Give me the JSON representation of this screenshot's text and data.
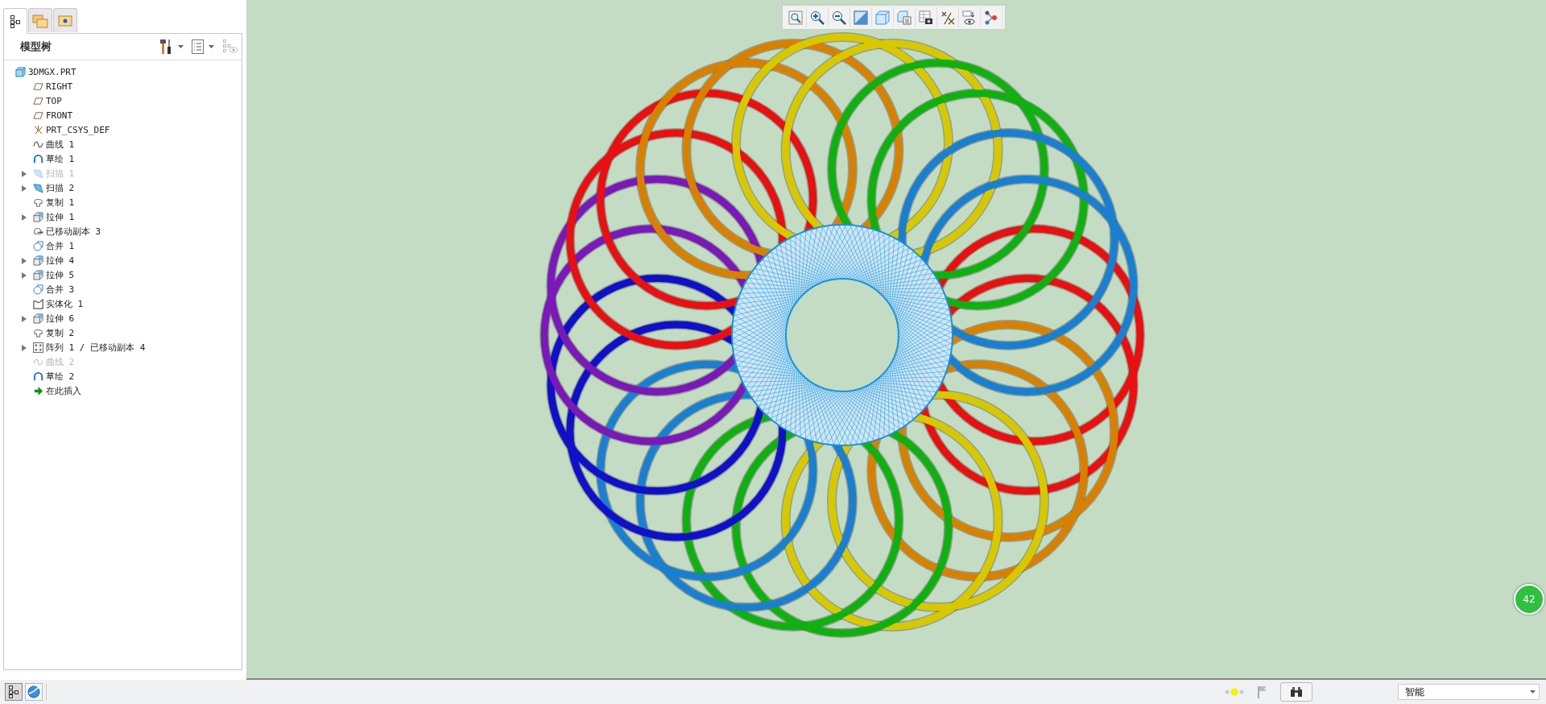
{
  "side_tabs": [
    {
      "kind": "tree",
      "selected": true
    },
    {
      "kind": "folders",
      "selected": false
    },
    {
      "kind": "favorites",
      "selected": false
    }
  ],
  "model_tree": {
    "title": "模型树",
    "root": {
      "label": "3DMGX.PRT",
      "kind": "part",
      "children": [
        {
          "label": "RIGHT",
          "kind": "plane",
          "expandable": false,
          "disabled": false
        },
        {
          "label": "TOP",
          "kind": "plane",
          "expandable": false,
          "disabled": false
        },
        {
          "label": "FRONT",
          "kind": "plane",
          "expandable": false,
          "disabled": false
        },
        {
          "label": "PRT_CSYS_DEF",
          "kind": "csys",
          "expandable": false,
          "disabled": false
        },
        {
          "label": "曲线 1",
          "kind": "curve",
          "expandable": false,
          "disabled": false
        },
        {
          "label": "草绘 1",
          "kind": "sketch",
          "expandable": false,
          "disabled": false
        },
        {
          "label": "扫描 1",
          "kind": "sweep",
          "expandable": true,
          "disabled": true
        },
        {
          "label": "扫描 2",
          "kind": "sweep",
          "expandable": true,
          "disabled": false
        },
        {
          "label": "复制 1",
          "kind": "copy",
          "expandable": false,
          "disabled": false
        },
        {
          "label": "拉伸 1",
          "kind": "extrude",
          "expandable": true,
          "disabled": false
        },
        {
          "label": "已移动副本 3",
          "kind": "moved",
          "expandable": false,
          "disabled": false
        },
        {
          "label": "合并 1",
          "kind": "merge",
          "expandable": false,
          "disabled": false
        },
        {
          "label": "拉伸 4",
          "kind": "extrude",
          "expandable": true,
          "disabled": false
        },
        {
          "label": "拉伸 5",
          "kind": "extrude",
          "expandable": true,
          "disabled": false
        },
        {
          "label": "合并 3",
          "kind": "merge",
          "expandable": false,
          "disabled": false
        },
        {
          "label": "实体化 1",
          "kind": "solidify",
          "expandable": false,
          "disabled": false
        },
        {
          "label": "拉伸 6",
          "kind": "extrude",
          "expandable": true,
          "disabled": false
        },
        {
          "label": "复制 2",
          "kind": "copy",
          "expandable": false,
          "disabled": false
        },
        {
          "label": "阵列 1 / 已移动副本 4",
          "kind": "pattern",
          "expandable": true,
          "disabled": false
        },
        {
          "label": "曲线 2",
          "kind": "curve",
          "expandable": false,
          "disabled": true
        },
        {
          "label": "草绘 2",
          "kind": "sketch",
          "expandable": false,
          "disabled": false
        },
        {
          "label": "在此插入",
          "kind": "insert",
          "expandable": false,
          "disabled": false
        }
      ]
    }
  },
  "view_toolbar": [
    {
      "kind": "refit"
    },
    {
      "kind": "zoom-in"
    },
    {
      "kind": "zoom-out"
    },
    {
      "kind": "repaint"
    },
    {
      "kind": "display-style"
    },
    {
      "kind": "saved-views"
    },
    {
      "kind": "view-manager"
    },
    {
      "kind": "datum-display"
    },
    {
      "kind": "visibility"
    },
    {
      "kind": "annotation"
    }
  ],
  "badge": "42",
  "status_bar": {
    "left_buttons": [
      {
        "kind": "tree",
        "selected": true
      },
      {
        "kind": "browser",
        "selected": false
      }
    ],
    "filter": "智能"
  }
}
